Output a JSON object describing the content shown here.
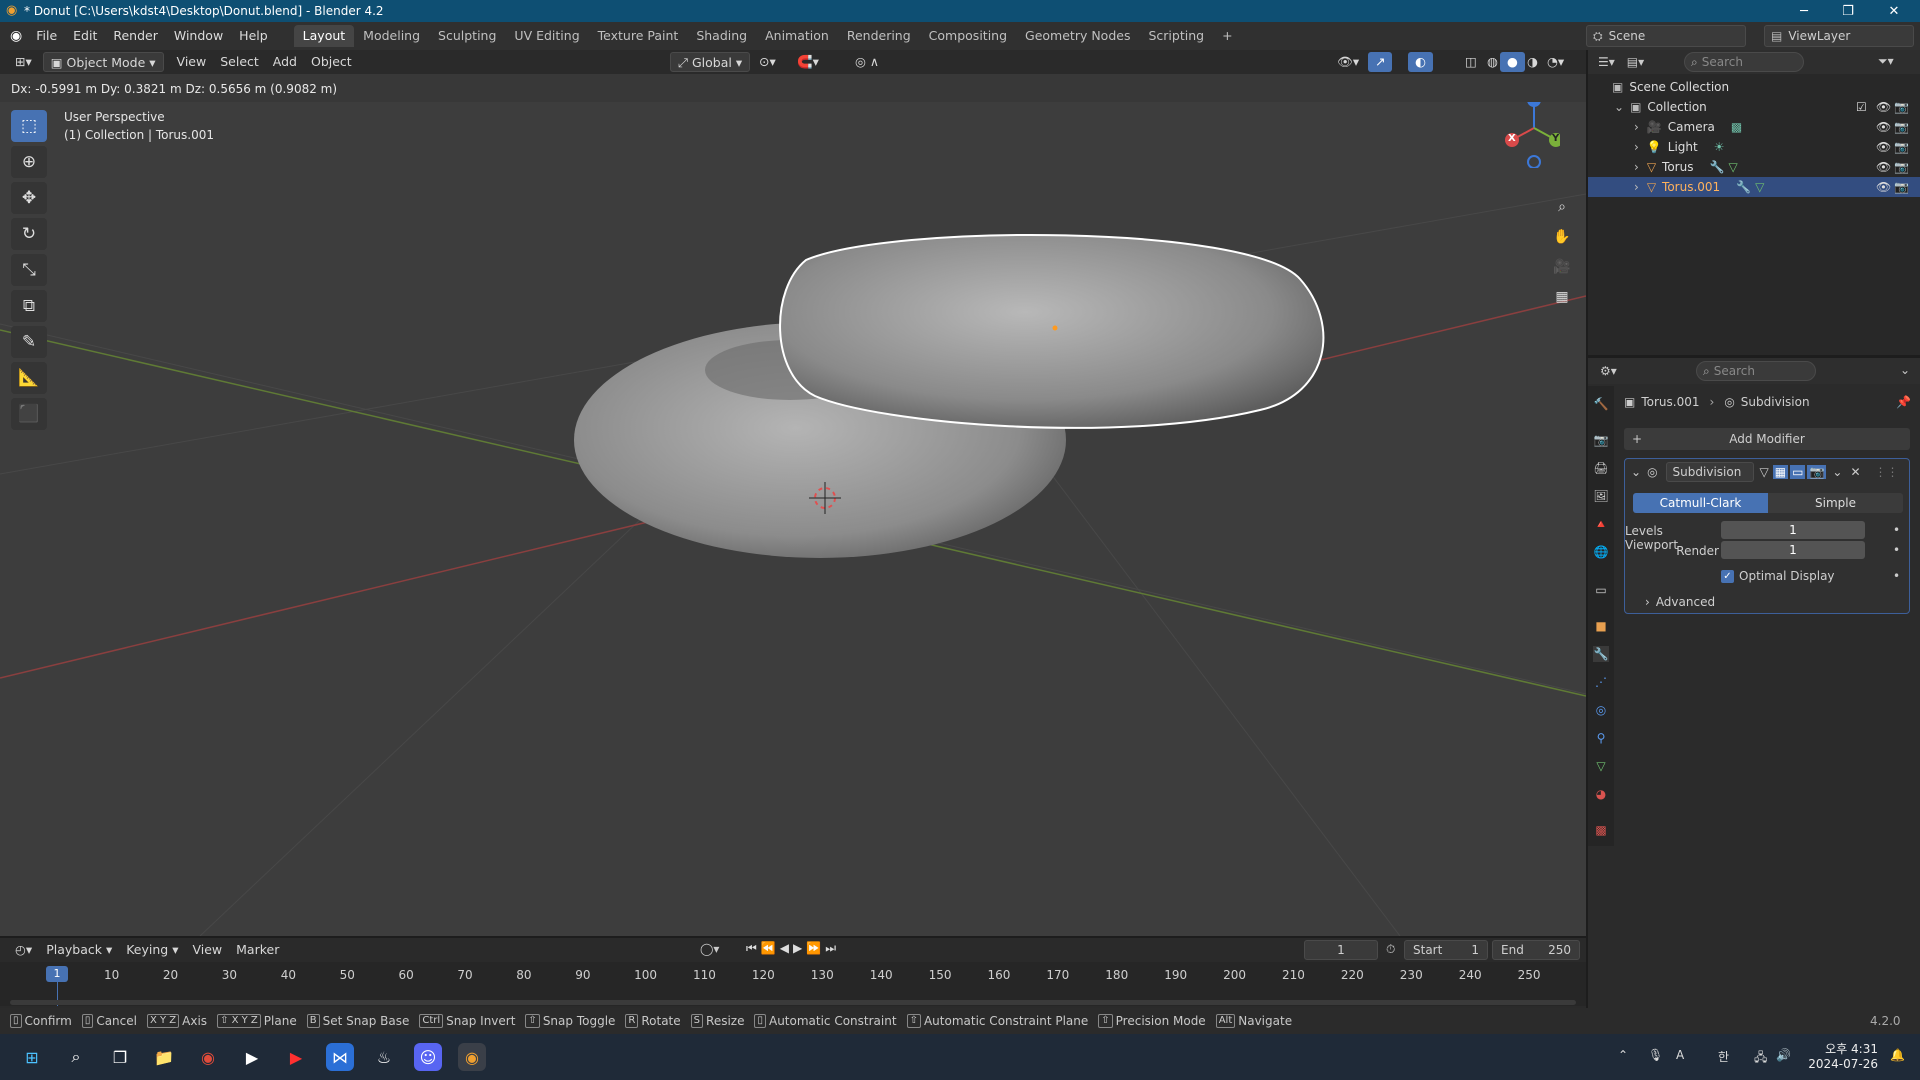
{
  "titlebar": {
    "title": "* Donut [C:\\Users\\kdst4\\Desktop\\Donut.blend] - Blender 4.2",
    "minimize": "─",
    "maximize": "❐",
    "close": "✕"
  },
  "menus": [
    "File",
    "Edit",
    "Render",
    "Window",
    "Help"
  ],
  "workspaces": [
    "Layout",
    "Modeling",
    "Sculpting",
    "UV Editing",
    "Texture Paint",
    "Shading",
    "Animation",
    "Rendering",
    "Compositing",
    "Geometry Nodes",
    "Scripting"
  ],
  "add_workspace": "+",
  "scene": {
    "label": "Scene",
    "viewlayer": "ViewLayer"
  },
  "viewport_header": {
    "mode": "Object Mode",
    "menus": [
      "View",
      "Select",
      "Add",
      "Object"
    ],
    "orientation": "Global"
  },
  "transform_info": "Dx: -0.5991 m   Dy: 0.3821 m   Dz: 0.5656 m (0.9082 m)",
  "overlay": {
    "perspective": "User Perspective",
    "collection": "(1) Collection | Torus.001"
  },
  "gizmo": {
    "x": "X",
    "y": "Y",
    "z": "Z"
  },
  "outliner": {
    "search_placeholder": "Search",
    "root": "Scene Collection",
    "collection": "Collection",
    "items": [
      "Camera",
      "Light",
      "Torus",
      "Torus.001"
    ]
  },
  "properties": {
    "search_placeholder": "Search",
    "breadcrumb_object": "Torus.001",
    "breadcrumb_modifier": "Subdivision",
    "add_modifier": "Add Modifier",
    "modifier_name": "Subdivision",
    "catmull": "Catmull-Clark",
    "simple": "Simple",
    "levels_label": "Levels Viewport",
    "levels_value": "1",
    "render_label": "Render",
    "render_value": "1",
    "optimal": "Optimal Display",
    "advanced": "Advanced"
  },
  "timeline": {
    "menus": [
      "Playback",
      "Keying",
      "View",
      "Marker"
    ],
    "current_frame": "1",
    "start_label": "Start",
    "start_value": "1",
    "end_label": "End",
    "end_value": "250",
    "ticks": [
      "10",
      "20",
      "30",
      "40",
      "50",
      "60",
      "70",
      "80",
      "90",
      "100",
      "110",
      "120",
      "130",
      "140",
      "150",
      "160",
      "170",
      "180",
      "190",
      "200",
      "210",
      "220",
      "230",
      "240",
      "250"
    ],
    "marker": "1"
  },
  "statusbar": {
    "items": [
      "Confirm",
      "Cancel",
      "Axis",
      "Plane",
      "Set Snap Base",
      "Snap Invert",
      "Snap Toggle",
      "Rotate",
      "Resize",
      "Automatic Constraint",
      "Automatic Constraint Plane",
      "Precision Mode",
      "Navigate"
    ],
    "keys": [
      "",
      "",
      "X Y Z",
      "⇧ X Y Z",
      "B",
      "Ctrl",
      "⇧",
      "R",
      "S",
      "",
      "⇧",
      "⇧",
      "Alt"
    ],
    "version": "4.2.0"
  },
  "taskbar": {
    "time": "오후 4:31",
    "date": "2024-07-26",
    "lang": "A",
    "ime": "한"
  }
}
